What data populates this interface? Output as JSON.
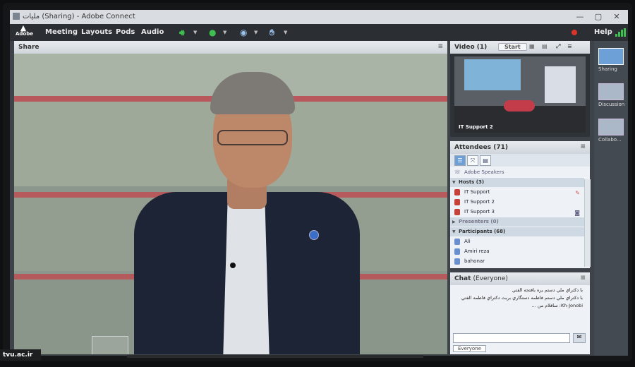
{
  "window": {
    "title": "ملیات (Sharing) - Adobe Connect",
    "minimize": "—",
    "restore": "▢",
    "close": "✕"
  },
  "logo": {
    "text": "Adobe"
  },
  "menu": {
    "items": [
      "Meeting",
      "Layouts",
      "Pods",
      "Audio"
    ],
    "help": "Help"
  },
  "share_pod": {
    "title": "Share",
    "menu": "≡"
  },
  "video_pod": {
    "title": "Video",
    "count": "(1)",
    "start": "Start",
    "participant": "IT Support 2"
  },
  "attendees": {
    "title": "Attendees",
    "count": "(71)",
    "adobe_speakers": "Adobe Speakers",
    "hosts_label": "Hosts (3)",
    "hosts": [
      "IT Support",
      "IT Support 2",
      "IT Support 3"
    ],
    "presenters_label": "Presenters (0)",
    "participants_label": "Participants (68)",
    "participants": [
      "Ali",
      "Amiri reza",
      "bahonar"
    ]
  },
  "chat": {
    "title": "Chat",
    "scope": "(Everyone)",
    "messages": [
      "با دكتراي ملي دستم يره بافتحه الفتي",
      "با دكتراي ملي دستم فاطمه دستگاري بربت دكتراي فاطمه الفتي",
      "Kh-Jonobi: ساقلام من ..."
    ],
    "to": "Everyone"
  },
  "layouts": {
    "items": [
      "Sharing",
      "Discussion",
      "Collabo..."
    ]
  },
  "watermark": {
    "text": "tvu.ac.ir"
  },
  "colors": {
    "accent": "#6da0d6",
    "record": "#d9342b",
    "mic_on": "#3fbf4f"
  },
  "icons": {
    "speaker": "speaker-icon",
    "microphone": "microphone-icon",
    "camera": "webcam-icon",
    "raise_hand": "raise-hand-icon"
  }
}
